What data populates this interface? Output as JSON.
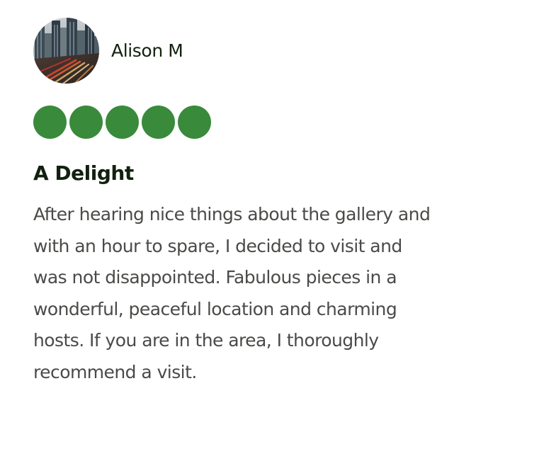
{
  "reviewer": {
    "name": "Alison M",
    "avatar_icon": "city-street-photo-icon"
  },
  "rating": {
    "value": 5,
    "max": 5,
    "color": "#398a3b"
  },
  "review": {
    "title": "A Delight",
    "body_lines": [
      "After hearing nice things about the gallery and",
      "with an hour to spare, I decided to visit and",
      "was not disappointed. Fabulous pieces in a",
      "wonderful, peaceful location and charming",
      "hosts. If you are in the area, I thoroughly",
      "recommend a visit."
    ]
  },
  "colors": {
    "name_text": "#12210f",
    "body_text": "#4a4a48",
    "background": "#ffffff"
  }
}
